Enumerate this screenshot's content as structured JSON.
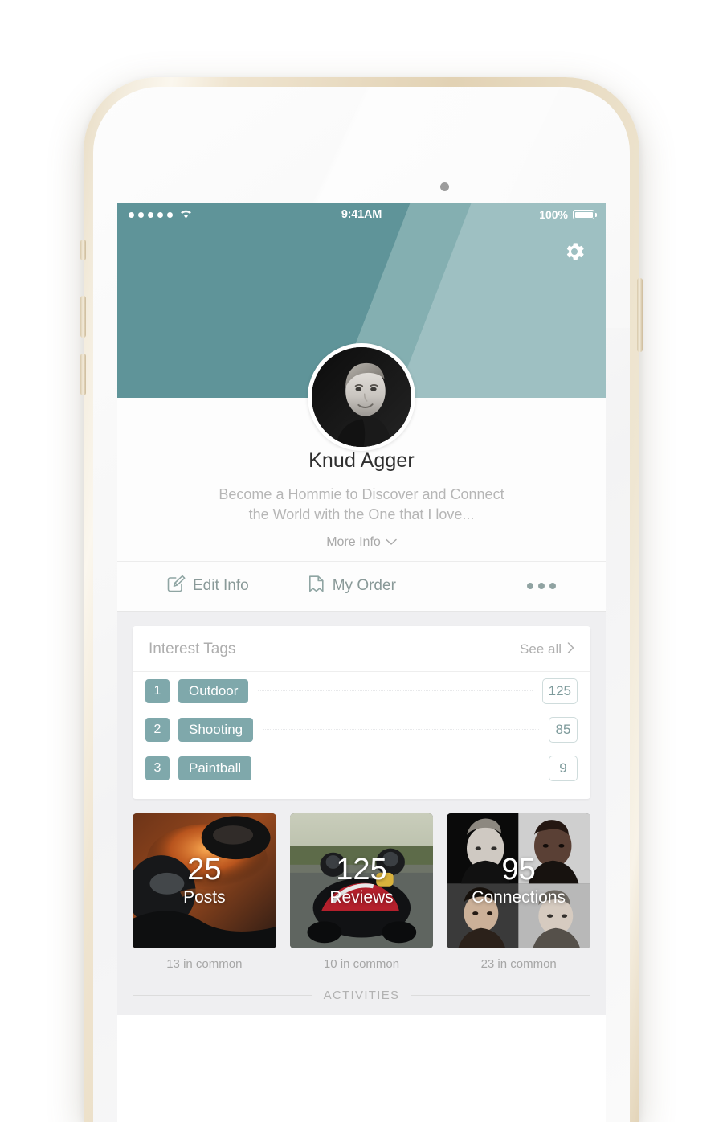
{
  "status_bar": {
    "signal_dots": 5,
    "wifi_icon": "wifi-icon",
    "time": "9:41AM",
    "battery_percent": "100%",
    "battery_icon": "battery-full-icon"
  },
  "cover": {
    "settings_icon": "gear-icon",
    "color_left": "#5f9499",
    "color_right": "#9ec0c2"
  },
  "profile": {
    "avatar_icon": "avatar",
    "name": "Knud Agger",
    "bio_line1": "Become a Hommie to Discover and Connect",
    "bio_line2": "the World with the One that I love...",
    "more_info_label": "More Info",
    "more_info_icon": "chevron-down-icon"
  },
  "actions": {
    "edit": {
      "label": "Edit Info",
      "icon": "edit-pencil-icon"
    },
    "order": {
      "label": "My Order",
      "icon": "bookmark-icon"
    },
    "more": {
      "icon": "ellipsis-icon"
    }
  },
  "interest_tags": {
    "title": "Interest Tags",
    "see_all_label": "See all",
    "see_all_icon": "chevron-right-icon",
    "accent_color": "#7fa8ab",
    "rows": [
      {
        "rank": "1",
        "tag": "Outdoor",
        "count": "125"
      },
      {
        "rank": "2",
        "tag": "Shooting",
        "count": "85"
      },
      {
        "rank": "3",
        "tag": "Paintball",
        "count": "9"
      }
    ]
  },
  "stats": [
    {
      "value": "25",
      "label": "Posts",
      "subtitle": "13 in common",
      "image": "paintball-photo"
    },
    {
      "value": "125",
      "label": "Reviews",
      "subtitle": "10 in common",
      "image": "go-kart-photo"
    },
    {
      "value": "95",
      "label": "Connections",
      "subtitle": "23 in common",
      "image": "people-grid-photo"
    }
  ],
  "activities": {
    "label": "ACTIVITIES"
  }
}
